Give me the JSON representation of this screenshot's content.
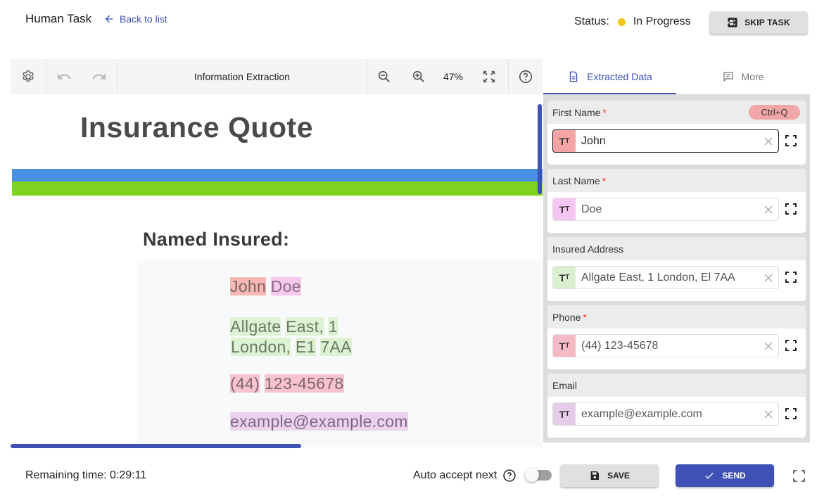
{
  "header": {
    "title": "Human Task",
    "back_label": "Back to list",
    "status_label": "Status:",
    "status_value": "In Progress",
    "status_color": "#f5c518",
    "skip_label": "SKIP TASK",
    "skip_icon": "exit-to-app-icon"
  },
  "toolbar": {
    "settings_icon": "gear-icon",
    "undo_icon": "undo-icon",
    "redo_icon": "redo-icon",
    "title": "Information Extraction",
    "zoom_out_icon": "zoom-out-icon",
    "zoom_in_icon": "zoom-in-icon",
    "zoom_level": "47%",
    "fit_icon": "fit-screen-icon",
    "help_icon": "help-icon"
  },
  "document": {
    "title": "Insurance Quote",
    "section": "Named Insured:",
    "first_name": "John",
    "last_name": "Doe",
    "address_line1_word1": "Allgate",
    "address_line1_word2": "East,",
    "address_line1_word3": "1",
    "address_line2_word1": "London,",
    "address_line2_word2": "E1",
    "address_line2_word3": "7AA",
    "phone_part1": "(44)",
    "phone_part2": "123-45678",
    "email": "example@example.com",
    "colors": {
      "blue_band": "#4a90e2",
      "green_band": "#7ed321"
    }
  },
  "panel": {
    "tabs": [
      {
        "label": "Extracted Data",
        "icon": "document-icon",
        "active": true
      },
      {
        "label": "More",
        "icon": "comment-icon",
        "active": false
      }
    ],
    "fields": [
      {
        "label": "First Name",
        "required": "*",
        "shortcut": "Ctrl+Q",
        "value": "John",
        "tag_color": "#f4a4a4",
        "focused": true
      },
      {
        "label": "Last Name",
        "required": "*",
        "value": "Doe",
        "tag_color": "#f6c6f2"
      },
      {
        "label": "Insured Address",
        "required": "",
        "value": "Allgate East, 1 London, El 7AA",
        "tag_color": "#d9efd0"
      },
      {
        "label": "Phone",
        "required": "*",
        "value": "(44) 123-45678",
        "tag_color": "#f6b9c6"
      },
      {
        "label": "Email",
        "required": "",
        "value": "example@example.com",
        "tag_color": "#e5cdea"
      }
    ],
    "type_icon_text": "T",
    "type_icon_small": "T",
    "clear_icon": "close-icon",
    "expand_icon": "expand-icon"
  },
  "footer": {
    "remaining_label": "Remaining time: 0:29:11",
    "auto_accept_label": "Auto accept next",
    "auto_accept_on": false,
    "save_label": "SAVE",
    "send_label": "SEND",
    "accent_color": "#3f51b5"
  }
}
